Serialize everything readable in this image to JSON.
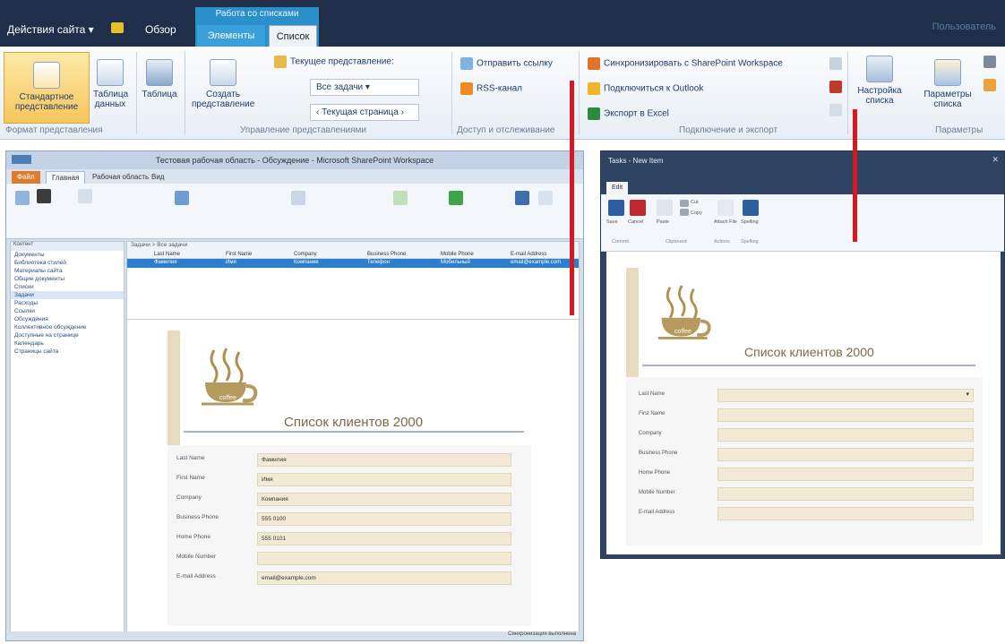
{
  "top_ribbon": {
    "site_actions": "Действия сайта ▾",
    "browse_tab": "Обзор",
    "context_group": "Работа со списками",
    "tabs": [
      "Элементы",
      "Список"
    ],
    "user": "Пользователь",
    "format_group": {
      "label": "Формат представления",
      "standard_view": "Стандартное представление",
      "datasheet_view": "Таблица данных"
    },
    "datasheet_group": {
      "table": "Таблица"
    },
    "manage_views_group": {
      "label": "Управление представлениями",
      "create_view": "Создать представление",
      "current_view_label": "Текущее представление:",
      "current_view_value": "Все задачи",
      "current_page": "Текущая страница"
    },
    "share_group": {
      "label": "Доступ и отслеживание",
      "email_link": "Отправить ссылку",
      "rss": "RSS-канал"
    },
    "connect_group": {
      "label": "Подключение и экспорт",
      "sync": "Синхронизировать с SharePoint Workspace",
      "outlook": "Подключиться к Outlook",
      "excel": "Экспорт в Excel"
    },
    "settings_group": {
      "label": "Параметры",
      "list_settings": "Настройка списка",
      "list_params": "Параметры списка"
    }
  },
  "left_window": {
    "title": "Тестовая рабочая область - Обсуждение - Microsoft SharePoint Workspace",
    "tabs": [
      "Файл",
      "Главная",
      "Рабочая область",
      "Вид"
    ],
    "nav_header": "Контент",
    "nav_items": [
      "Документы",
      "Библиотека стилей",
      "Материалы сайта",
      "Общие документы",
      "Списки",
      "Задачи",
      "Расходы",
      "Ссылки",
      "Обсуждения",
      "Коллективное обсуждение",
      "Доступные на странице",
      "Календарь",
      "Страницы сайта"
    ],
    "path": "Задачи > Все задачи",
    "columns": [
      "Last Name",
      "First Name",
      "Company",
      "Business Phone",
      "Mobile Phone",
      "E-mail Address"
    ],
    "selected_row": [
      "Фамилия",
      "Имя",
      "Компания",
      "Телефон",
      "Мобильный",
      "email@example.com"
    ],
    "status": "Синхронизация выполнена"
  },
  "form": {
    "title": "Список клиентов 2000",
    "cup_text": "coffee",
    "fields": [
      {
        "label": "Last Name",
        "value": "Фамилия"
      },
      {
        "label": "First Name",
        "value": "Имя"
      },
      {
        "label": "Company",
        "value": "Компания"
      },
      {
        "label": "Business Phone",
        "value": "555 0100"
      },
      {
        "label": "Home Phone",
        "value": "555 0101"
      },
      {
        "label": "Mobile Number",
        "value": ""
      },
      {
        "label": "E-mail Address",
        "value": "email@example.com"
      }
    ]
  },
  "right_window": {
    "title": "Tasks - New Item",
    "tab": "Edit",
    "buttons": [
      "Save",
      "Cancel",
      "Paste",
      "Cut",
      "Copy",
      "Attach File",
      "Spelling"
    ],
    "groups": [
      "Commit",
      "Clipboard",
      "Actions",
      "Spelling"
    ]
  },
  "colors": {
    "accent": "#2b8fcc",
    "highlight": "#d41920",
    "form_field": "#f3ead6"
  }
}
